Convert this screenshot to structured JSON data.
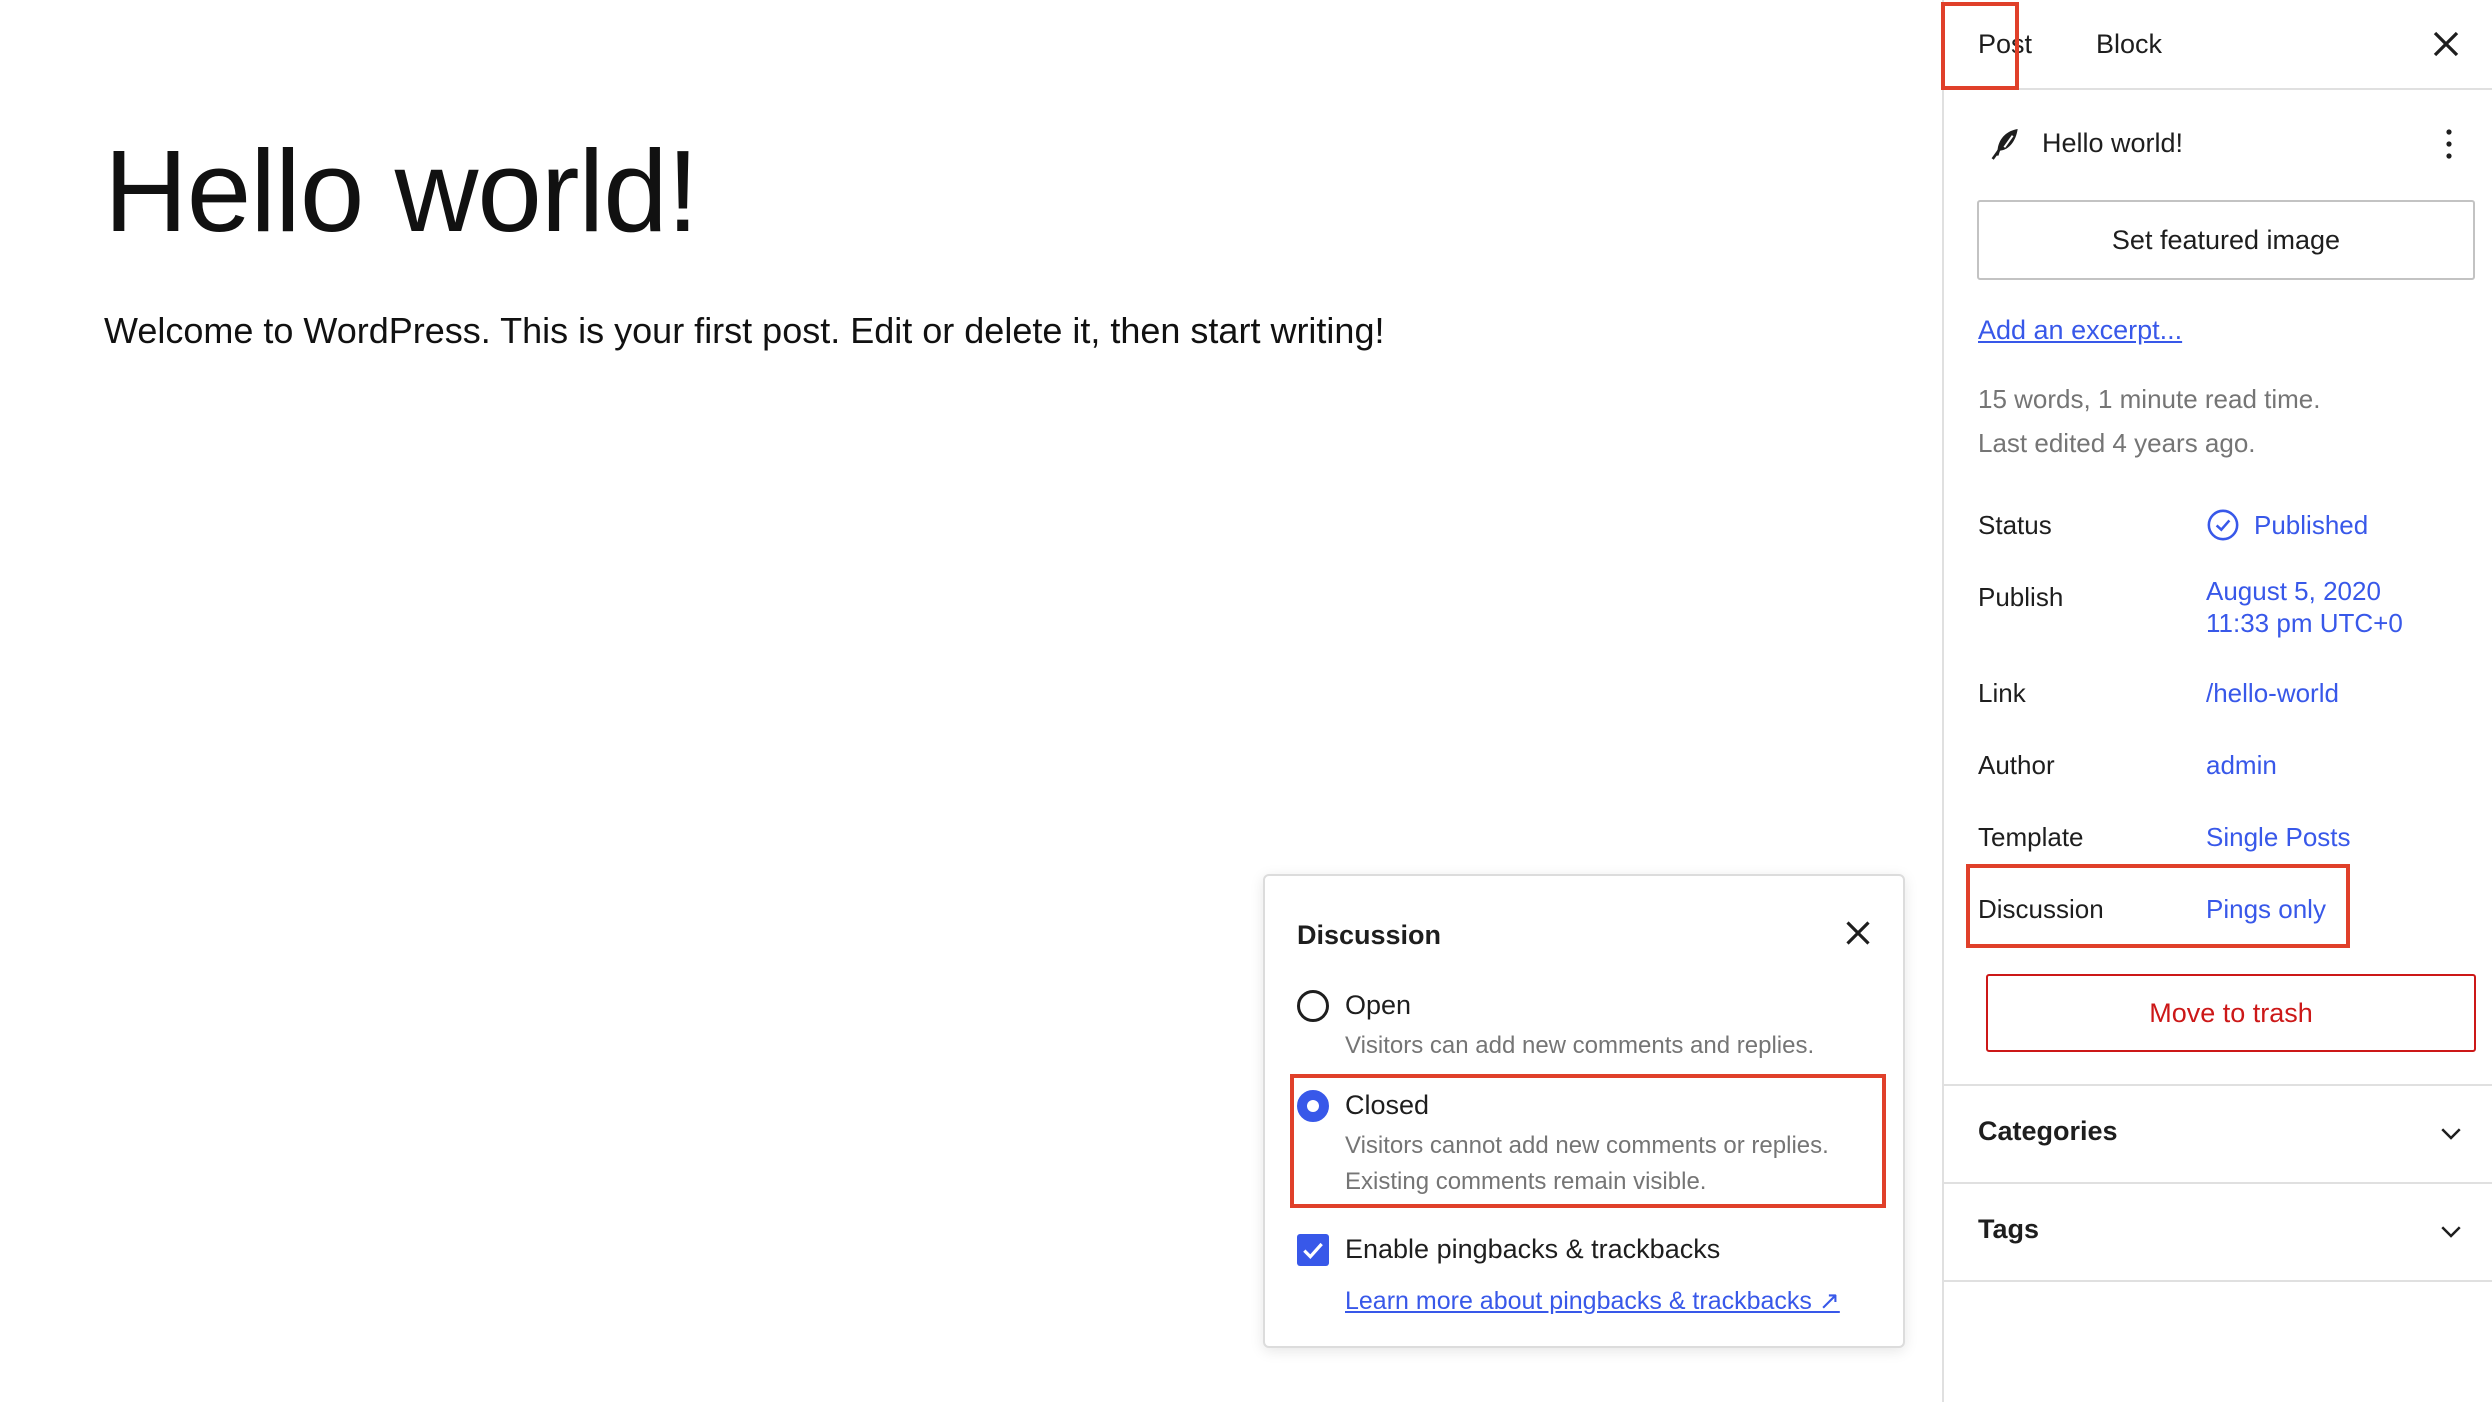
{
  "editor": {
    "title": "Hello world!",
    "body": "Welcome to WordPress. This is your first post. Edit or delete it, then start writing!"
  },
  "sidebar": {
    "tabs": [
      {
        "label": "Post",
        "active": true
      },
      {
        "label": "Block",
        "active": false
      }
    ],
    "post_title": "Hello world!",
    "featured_image_label": "Set featured image",
    "excerpt_link": "Add an excerpt...",
    "word_count": "15 words, 1 minute read time.",
    "last_edited": "Last edited 4 years ago.",
    "properties": {
      "status": {
        "label": "Status",
        "value": "Published"
      },
      "publish": {
        "label": "Publish",
        "value_line1": "August 5, 2020",
        "value_line2": "11:33 pm UTC+0"
      },
      "link": {
        "label": "Link",
        "value": "/hello-world"
      },
      "author": {
        "label": "Author",
        "value": "admin"
      },
      "template": {
        "label": "Template",
        "value": "Single Posts"
      },
      "discussion": {
        "label": "Discussion",
        "value": "Pings only"
      }
    },
    "trash_label": "Move to trash",
    "panels": [
      {
        "title": "Categories",
        "expanded": false
      },
      {
        "title": "Tags",
        "expanded": false
      }
    ]
  },
  "discussion_popover": {
    "title": "Discussion",
    "options": [
      {
        "label": "Open",
        "help": "Visitors can add new comments and replies.",
        "selected": false
      },
      {
        "label": "Closed",
        "help_line1": "Visitors cannot add new comments or replies.",
        "help_line2": "Existing comments remain visible.",
        "selected": true
      }
    ],
    "pingbacks": {
      "label": "Enable pingbacks & trackbacks",
      "checked": true
    },
    "learn_more": "Learn more about pingbacks & trackbacks ↗"
  },
  "colors": {
    "accent": "#3858e9",
    "danger": "#cc1818",
    "highlight": "#e0402a",
    "muted_text": "#757575"
  },
  "icons": [
    "close-icon",
    "feather-icon",
    "more-vertical-icon",
    "check-circle-icon",
    "chevron-down-icon",
    "external-link-icon"
  ]
}
